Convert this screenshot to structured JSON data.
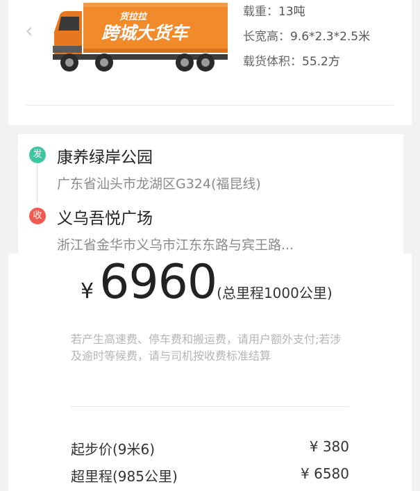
{
  "vehicle": {
    "truck_banner_small": "货拉拉",
    "truck_banner_large": "跨城大货车",
    "specs": [
      {
        "label": "载重：",
        "value": "13吨"
      },
      {
        "label": "长宽高：",
        "value": "9.6*2.3*2.5米"
      },
      {
        "label": "载货体积：",
        "value": "55.2方"
      }
    ]
  },
  "route": {
    "start": {
      "badge": "发",
      "name": "康养绿岸公园",
      "address": "广东省汕头市龙湖区G324(福昆线)"
    },
    "end": {
      "badge": "收",
      "name": "义乌吾悦广场",
      "address": "浙江省金华市义乌市江东东路与宾王路..."
    }
  },
  "price": {
    "currency": "¥",
    "amount": "6960",
    "distance_note": "(总里程1000公里)",
    "fee_note": "若产生高速费、停车费和搬运费，请用户额外支付;若涉及逾时等候费，请与司机按收费标准结算",
    "items": [
      {
        "label": "起步价(9米6)",
        "value": "¥ 380"
      },
      {
        "label": "超里程(985公里)",
        "value": "¥ 6580"
      }
    ]
  },
  "colors": {
    "truck_orange": "#f08a2a",
    "start_badge": "#3dc6a0",
    "end_badge": "#f25a4d"
  },
  "icons": {
    "prev": "chevron-left-icon"
  }
}
